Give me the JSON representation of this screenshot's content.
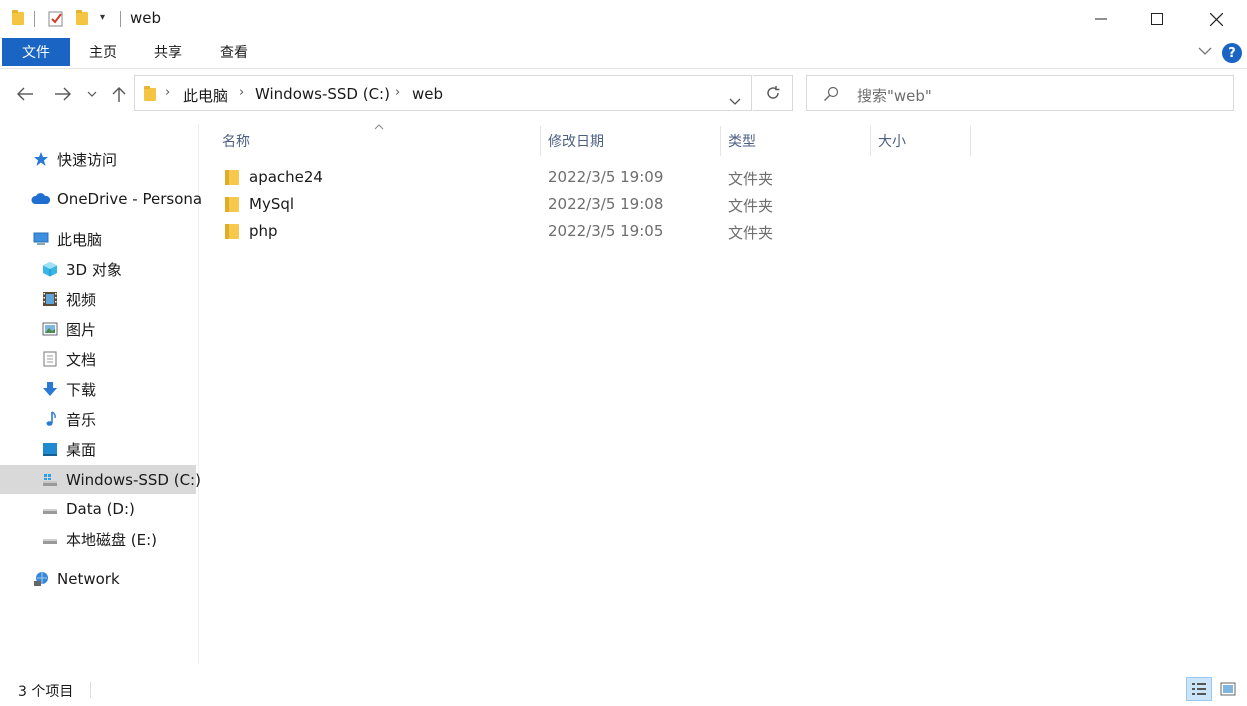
{
  "window": {
    "title": "web"
  },
  "ribbon": {
    "tabs": [
      "文件",
      "主页",
      "共享",
      "查看"
    ]
  },
  "address": {
    "breadcrumbs": [
      "此电脑",
      "Windows-SSD (C:)",
      "web"
    ],
    "search_placeholder": "搜索\"web\""
  },
  "nav": {
    "quick_access": "快速访问",
    "onedrive": "OneDrive - Persona",
    "this_pc": "此电脑",
    "pc_items": [
      "3D 对象",
      "视频",
      "图片",
      "文档",
      "下载",
      "音乐",
      "桌面",
      "Windows-SSD (C:)",
      "Data (D:)",
      "本地磁盘 (E:)"
    ],
    "network": "Network",
    "selected": "Windows-SSD (C:)"
  },
  "columns": {
    "name": "名称",
    "date": "修改日期",
    "type": "类型",
    "size": "大小"
  },
  "files": [
    {
      "name": "apache24",
      "date": "2022/3/5 19:09",
      "type": "文件夹"
    },
    {
      "name": "MySql",
      "date": "2022/3/5 19:08",
      "type": "文件夹"
    },
    {
      "name": "php",
      "date": "2022/3/5 19:05",
      "type": "文件夹"
    }
  ],
  "status": {
    "count": "3 个项目"
  },
  "colors": {
    "accent": "#1a64c4",
    "selected_bg": "#d9d9d9",
    "header_text": "#4d6082"
  }
}
